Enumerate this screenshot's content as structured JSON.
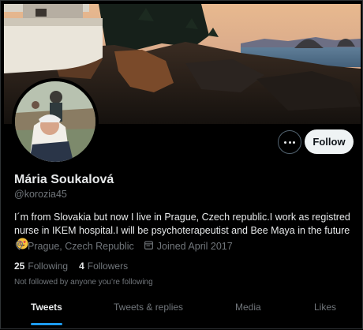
{
  "profile": {
    "name": "Mária Soukalová",
    "handle": "@korozia45",
    "bio": "I´m from Slovakia but now I live in Prague, Czech republic.I work as registred nurse in IKEM hospital.I will be psychoterapeutist and Bee Maya in the future",
    "bio_emoji": "heart-eyes-emoji",
    "location": "Prague, Czech Republic",
    "joined": "Joined April 2017",
    "following_count": "25",
    "following_label": "Following",
    "followers_count": "4",
    "followers_label": "Followers",
    "followed_by_notice": "Not followed by anyone you’re following"
  },
  "actions": {
    "more_icon": "more-horizontal-icon",
    "follow_label": "Follow"
  },
  "tabs": [
    {
      "label": "Tweets",
      "active": true
    },
    {
      "label": "Tweets & replies",
      "active": false
    },
    {
      "label": "Media",
      "active": false
    },
    {
      "label": "Likes",
      "active": false
    }
  ],
  "colors": {
    "background": "#000000",
    "primary_text": "#e7e9ea",
    "secondary_text": "#71767b",
    "accent": "#1d9bf0",
    "follow_button_bg": "#eff3f4"
  }
}
